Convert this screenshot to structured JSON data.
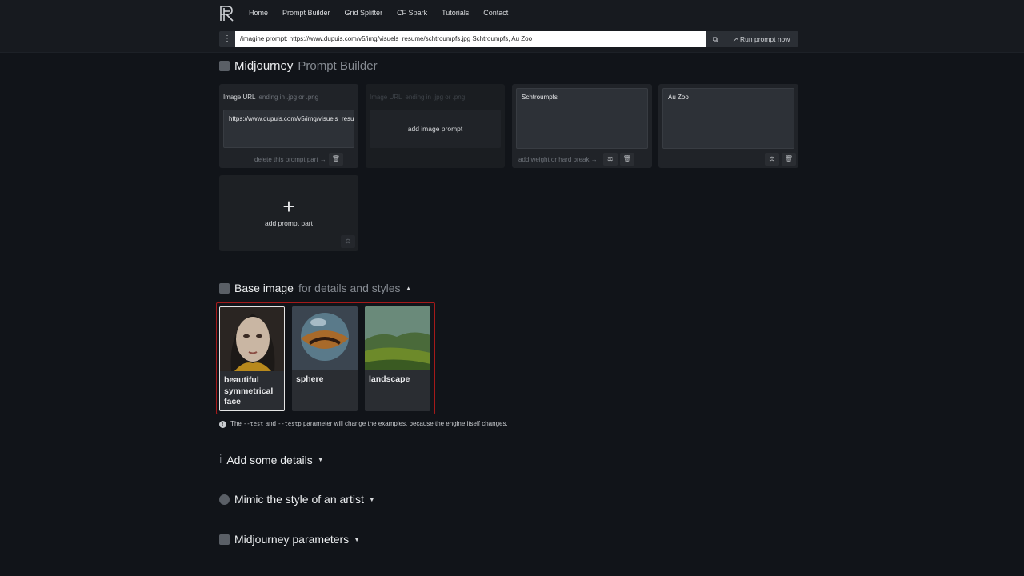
{
  "nav": {
    "items": [
      "Home",
      "Prompt Builder",
      "Grid Splitter",
      "CF Spark",
      "Tutorials",
      "Contact"
    ]
  },
  "command": {
    "prompt": "/imagine prompt: https://www.dupuis.com/v5/img/visuels_resume/schtroumpfs.jpg Schtroumpfs, Au Zoo",
    "menu_icon": "⋮",
    "copy_icon": "⧉",
    "run_label": "Run prompt now"
  },
  "builder": {
    "title_main": "Midjourney",
    "title_rest": "Prompt Builder",
    "image_card": {
      "label": "Image URL",
      "hint": "ending in .jpg or .png",
      "value": "https://www.dupuis.com/v5/img/visuels_resume/schtroumpfs.jpg",
      "delete_label": "delete this prompt part →"
    },
    "add_image_card": {
      "label": "Image URL",
      "hint": "ending in .jpg or .png",
      "button": "add image prompt"
    },
    "text_parts": [
      {
        "value": "Schtroumpfs",
        "footer": "add weight or hard break →"
      },
      {
        "value": "Au Zoo",
        "footer": ""
      }
    ],
    "add_part": {
      "plus": "+",
      "label": "add prompt part"
    }
  },
  "base_image": {
    "title_main": "Base image",
    "title_rest": "for details and styles",
    "tiles": [
      {
        "caption": "beautiful symmetrical face",
        "selected": true
      },
      {
        "caption": "sphere",
        "selected": false
      },
      {
        "caption": "landscape",
        "selected": false
      }
    ],
    "note_pre": "The",
    "note_code1": "--test",
    "note_mid": "and",
    "note_code2": "--testp",
    "note_post": "parameter will change the examples, because the engine itself changes."
  },
  "sections": [
    {
      "label": "Add some details"
    },
    {
      "label": "Mimic the style of an artist"
    },
    {
      "label": "Midjourney parameters"
    }
  ],
  "colors": {
    "background": "#111419",
    "card": "#202328",
    "selection_border": "#a51a1a"
  }
}
